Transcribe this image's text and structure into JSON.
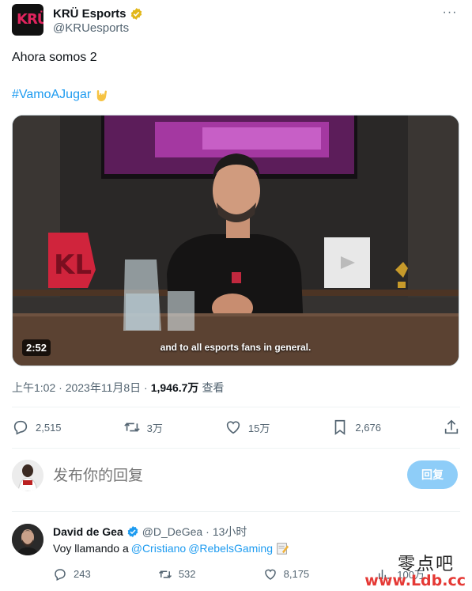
{
  "author": {
    "display_name": "KRÜ Esports",
    "handle": "@KRUesports",
    "logo_text": "KRÜ"
  },
  "tweet": {
    "text": "Ahora somos 2",
    "hashtag": "#VamoAJugar"
  },
  "media": {
    "duration": "2:52",
    "caption": "and to all esports fans in general."
  },
  "meta": {
    "timestamp": "上午1:02 · 2023年11月8日 ·",
    "views": "1,946.7万",
    "views_label": "查看"
  },
  "actions": {
    "replies": "2,515",
    "retweets": "3万",
    "likes": "15万",
    "bookmarks": "2,676"
  },
  "reply_box": {
    "placeholder": "发布你的回复",
    "button_label": "回复"
  },
  "comment": {
    "display_name": "David de Gea",
    "handle": "@D_DeGea",
    "separator": "·",
    "time": "13小时",
    "text_prefix": "Voy llamando a",
    "mention_1": "@Cristiano",
    "mention_2": "@RebelsGaming",
    "replies": "243",
    "retweets": "532",
    "likes": "8,175",
    "views": "100万"
  },
  "watermark": {
    "top": "零点吧",
    "bottom": "www.Ldb.cc"
  },
  "colors": {
    "accent": "#1d9bf0",
    "secondary_text": "#536471",
    "reply_button": "#8ecdf8"
  }
}
